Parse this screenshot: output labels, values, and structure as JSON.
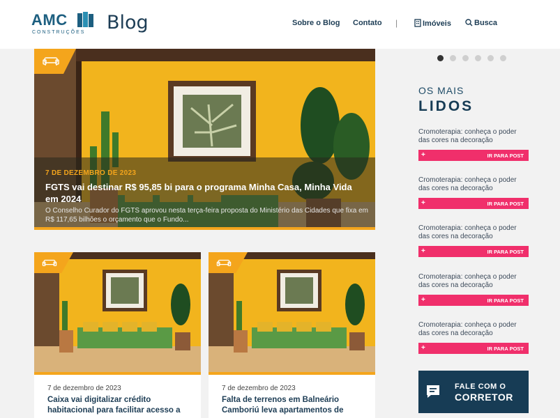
{
  "header": {
    "logo_text": "AMC",
    "logo_subtext": "CONSTRUÇÕES",
    "blog_title": "Blog",
    "nav": {
      "about": "Sobre o Blog",
      "contact": "Contato",
      "separator": "|",
      "properties": "Imóveis",
      "search": "Busca"
    }
  },
  "featured": {
    "date": "7 DE DEZEMBRO DE 2023",
    "title": "FGTS vai destinar R$ 95,85 bi para o programa Minha Casa, Minha Vida em 2024",
    "excerpt": "O Conselho Curador do FGTS aprovou nesta terça-feira proposta do Ministério das Cidades que fixa em R$ 117,65 bilhões o orçamento que o Fundo..."
  },
  "cards": [
    {
      "date": "7 de dezembro de 2023",
      "title": "Caixa vai digitalizar crédito habitacional para facilitar acesso a"
    },
    {
      "date": "7 de dezembro de 2023",
      "title": "Falta de terrenos em Balneário Camboriú leva apartamentos de"
    }
  ],
  "carousel": {
    "count": 6,
    "active": 1
  },
  "most_read": {
    "line1": "OS MAIS",
    "line2": "LIDOS",
    "items": [
      {
        "title": "Cromoterapia: conheça o poder das cores na decoração",
        "button": "IR PARA POST",
        "plus": "+"
      },
      {
        "title": "Cromoterapia: conheça o poder das cores na decoração",
        "button": "IR PARA POST",
        "plus": "+"
      },
      {
        "title": "Cromoterapia: conheça o poder das cores na decoração",
        "button": "IR PARA POST",
        "plus": "+"
      },
      {
        "title": "Cromoterapia: conheça o poder das cores na decoração",
        "button": "IR PARA POST",
        "plus": "+"
      },
      {
        "title": "Cromoterapia: conheça o poder das cores na decoração",
        "button": "IR PARA POST",
        "plus": "+"
      }
    ]
  },
  "cta": {
    "line1": "FALE COM O",
    "line2": "CORRETOR"
  },
  "colors": {
    "accent": "#f4a51c",
    "brand": "#173c55",
    "pink": "#f02f6b",
    "wall": "#f2b41d"
  }
}
